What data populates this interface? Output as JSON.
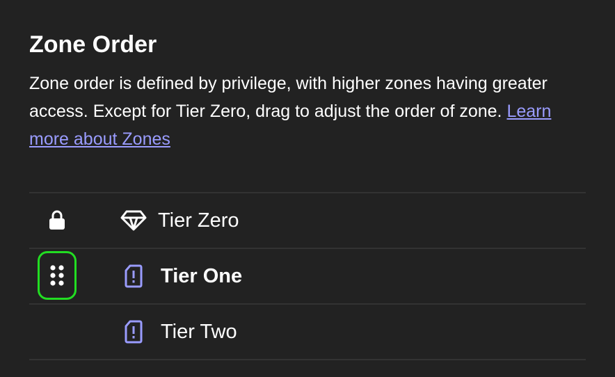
{
  "header": {
    "title": "Zone Order",
    "description": "Zone order is defined by privilege, with higher zones having greater access. Except for Tier Zero, drag to adjust the order of zone.",
    "learn_more_link": "Learn more about Zones"
  },
  "zones": [
    {
      "name": "Tier Zero",
      "handle_icon": "lock-icon",
      "zone_icon": "diamond-icon",
      "selected": false
    },
    {
      "name": "Tier One",
      "handle_icon": "drag-handle-icon",
      "zone_icon": "tag-alert-icon",
      "selected": true
    },
    {
      "name": "Tier Two",
      "handle_icon": "none",
      "zone_icon": "tag-alert-icon",
      "selected": false
    }
  ],
  "colors": {
    "background": "#222222",
    "text": "#ffffff",
    "link": "#9a9cff",
    "zone_icon": "#9a9cff",
    "focus_ring": "#22dd22",
    "divider": "#333333"
  }
}
